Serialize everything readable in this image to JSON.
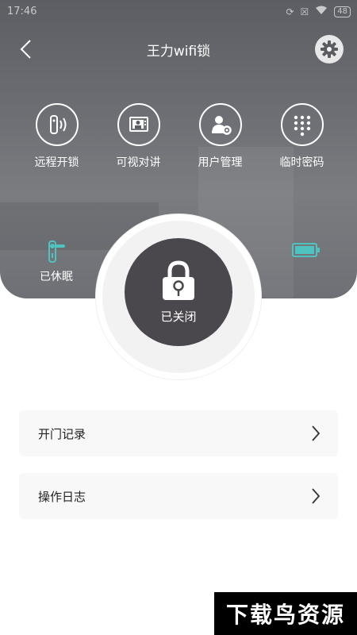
{
  "status_bar": {
    "time": "17:46",
    "battery": "48"
  },
  "header": {
    "title": "王力wifi锁"
  },
  "actions": [
    {
      "label": "远程开锁",
      "icon": "remote-unlock-icon"
    },
    {
      "label": "可视对讲",
      "icon": "video-intercom-icon"
    },
    {
      "label": "用户管理",
      "icon": "user-manage-icon"
    },
    {
      "label": "临时密码",
      "icon": "keypad-icon"
    }
  ],
  "device": {
    "sleep_label": "已休眠",
    "lock_state": "已关闭"
  },
  "menu": [
    {
      "label": "开门记录"
    },
    {
      "label": "操作日志"
    }
  ],
  "watermark": "下载鸟资源",
  "colors": {
    "accent": "#4fc3c0",
    "lock_bg": "#4a484d"
  }
}
